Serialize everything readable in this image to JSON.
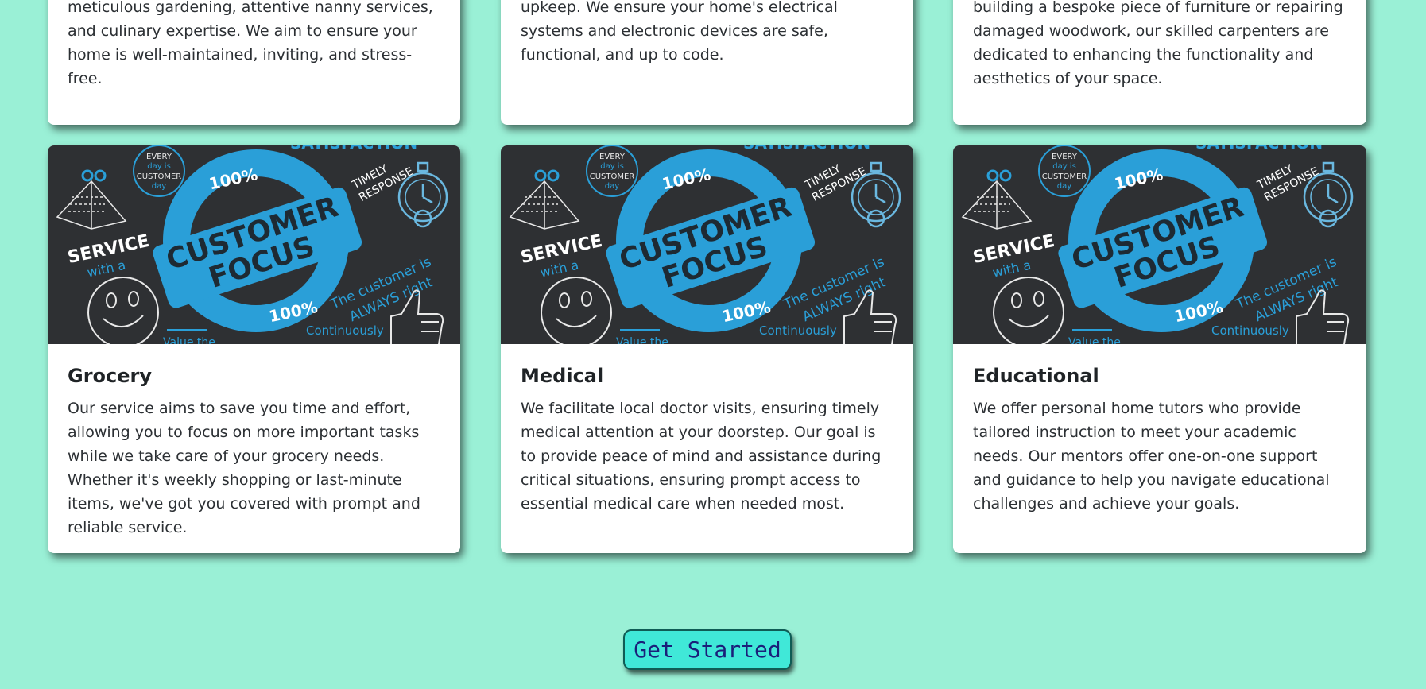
{
  "top_cards": [
    {
      "text": "meticulous gardening, attentive nanny services, and culinary expertise. We aim to ensure your home is well-maintained, inviting, and stress-free."
    },
    {
      "text": "upkeep. We ensure your home's electrical systems and electronic devices are safe, functional, and up to code."
    },
    {
      "text": "building a bespoke piece of furniture or repairing damaged woodwork, our skilled carpenters are dedicated to enhancing the functionality and aesthetics of your space."
    }
  ],
  "service_cards": [
    {
      "title": "Grocery",
      "text": "Our service aims to save you time and effort, allowing you to focus on more important tasks while we take care of your grocery needs. Whether it's weekly shopping or last-minute items, we've got you covered with prompt and reliable service."
    },
    {
      "title": "Medical",
      "text": "We facilitate local doctor visits, ensuring timely medical attention at your doorstep. Our goal is to provide peace of mind and assistance during critical situations, ensuring prompt access to essential medical care when needed most."
    },
    {
      "title": "Educational",
      "text": "We offer personal home tutors who provide tailored instruction to meet your academic needs. Our mentors offer one-on-one support and guidance to help you navigate educational challenges and achieve your goals."
    }
  ],
  "banner": {
    "top_arc": "SATISFACTION",
    "every": [
      "EVERY",
      "day is",
      "CUSTOMER",
      "day"
    ],
    "pct_top": "100%",
    "pct_bottom": "100%",
    "main_1": "CUSTOMER",
    "main_2": "FOCUS",
    "timely": [
      "TIMELY",
      "RESPONSE"
    ],
    "service": "SERVICE",
    "with_a": "with a",
    "customer_is": "The customer is",
    "always_right": "ALWAYS right",
    "value_the": "Value the",
    "continuously": "Continuously"
  },
  "cta": {
    "label": "Get Started"
  },
  "colors": {
    "background": "#9af0d6",
    "card": "#ffffff",
    "cta_bg": "#40e8d8",
    "cta_text": "#1a1f7a",
    "banner_dark": "#2e3033",
    "banner_blue": "#2a9fd8"
  },
  "icons": [
    "calendar-icon",
    "stopwatch-icon",
    "smiley-icon",
    "thumbs-up-icon"
  ]
}
